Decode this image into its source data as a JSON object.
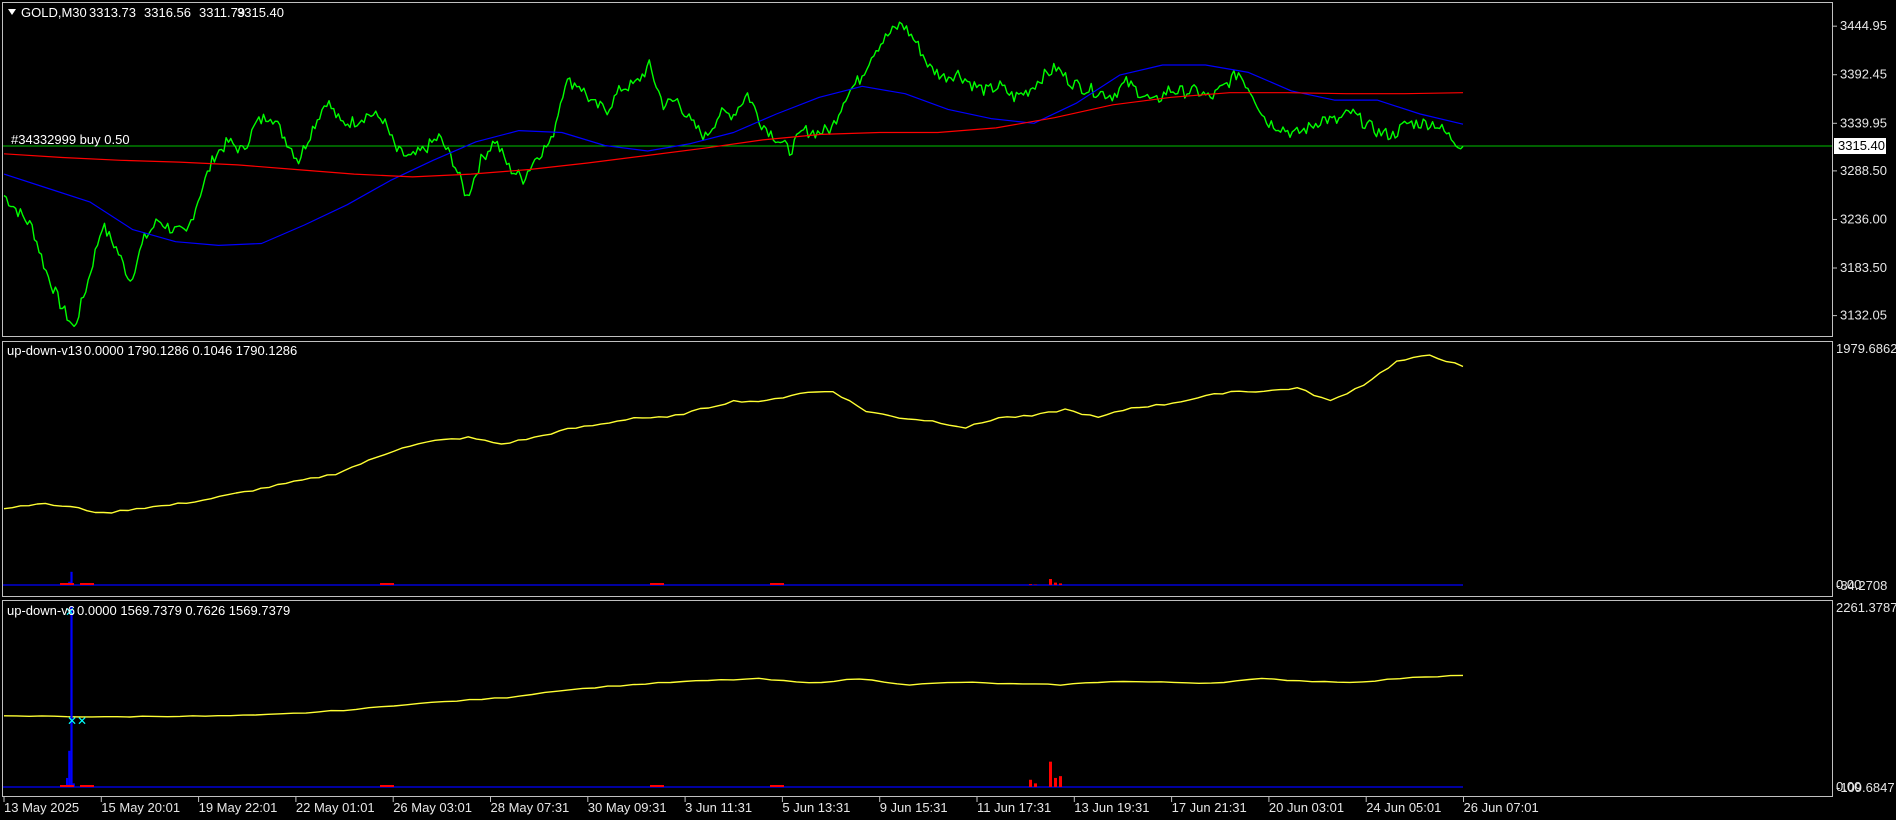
{
  "chart_data": [
    {
      "type": "line",
      "title": "GOLD,M30",
      "ohlc": {
        "open": "3313.73",
        "high": "3316.56",
        "low": "3311.79",
        "close": "3315.40"
      },
      "order_label": "#34332999 buy 0.50",
      "current_price_label": "3315.40",
      "current_price": 3315.4,
      "ylim": [
        3110,
        3470
      ],
      "y_ticks": [
        "3444.95",
        "3392.45",
        "3339.95",
        "3288.50",
        "3236.00",
        "3183.50",
        "3132.05"
      ],
      "y_tick_values": [
        3444.95,
        3392.45,
        3339.95,
        3288.5,
        3236.0,
        3183.5,
        3132.05
      ],
      "series": [
        {
          "color": "#00ff00",
          "values": [
            3262,
            3245,
            3228,
            3180,
            3145,
            3118,
            3170,
            3230,
            3205,
            3170,
            3215,
            3235,
            3225,
            3220,
            3265,
            3305,
            3320,
            3310,
            3340,
            3350,
            3325,
            3300,
            3335,
            3365,
            3340,
            3342,
            3350,
            3345,
            3310,
            3302,
            3312,
            3325,
            3300,
            3260,
            3300,
            3322,
            3292,
            3280,
            3305,
            3320,
            3385,
            3382,
            3360,
            3355,
            3378,
            3382,
            3402,
            3360,
            3365,
            3340,
            3325,
            3350,
            3350,
            3372,
            3340,
            3325,
            3310,
            3332,
            3330,
            3334,
            3370,
            3388,
            3418,
            3435,
            3448,
            3428,
            3400,
            3390,
            3394,
            3382,
            3375,
            3380,
            3368,
            3375,
            3390,
            3400,
            3385,
            3378,
            3374,
            3370,
            3384,
            3373,
            3362,
            3376,
            3374,
            3375,
            3367,
            3380,
            3395,
            3372,
            3342,
            3336,
            3328,
            3335,
            3345,
            3342,
            3352,
            3340,
            3330,
            3327,
            3340,
            3340,
            3340,
            3326,
            3315
          ]
        },
        {
          "color": "#0000ff",
          "values": [
            3285,
            3270,
            3255,
            3225,
            3212,
            3208,
            3210,
            3230,
            3252,
            3278,
            3300,
            3320,
            3332,
            3330,
            3316,
            3310,
            3318,
            3330,
            3350,
            3368,
            3380,
            3372,
            3355,
            3345,
            3340,
            3362,
            3392,
            3403,
            3403,
            3395,
            3375,
            3365,
            3365,
            3350,
            3339
          ]
        },
        {
          "color": "#ff0000",
          "values": [
            3307,
            3303,
            3300,
            3298,
            3295,
            3290,
            3285,
            3282,
            3285,
            3290,
            3297,
            3305,
            3313,
            3322,
            3328,
            3330,
            3330,
            3335,
            3346,
            3360,
            3368,
            3373,
            3373,
            3372,
            3372,
            3373
          ]
        }
      ]
    },
    {
      "type": "line",
      "title": "up-down-v13",
      "header_values": "0.0000 1790.1286 0.1046 1790.1286",
      "top_label": "1979.6862",
      "bottom_labels": [
        "0.00",
        "-84.2708"
      ],
      "series": [
        {
          "color": "#ffff33",
          "values": [
            0.07,
            0.1,
            0.08,
            0.04,
            0.07,
            0.09,
            0.12,
            0.16,
            0.2,
            0.24,
            0.28,
            0.36,
            0.44,
            0.48,
            0.5,
            0.46,
            0.5,
            0.55,
            0.58,
            0.62,
            0.62,
            0.67,
            0.72,
            0.72,
            0.77,
            0.78,
            0.66,
            0.62,
            0.6,
            0.56,
            0.62,
            0.63,
            0.67,
            0.62,
            0.68,
            0.7,
            0.74,
            0.78,
            0.78,
            0.8,
            0.72,
            0.82,
            0.96,
            1.0,
            0.93
          ]
        },
        {
          "color": "#0000ff",
          "values": [
            0.05,
            0.08,
            0.33,
            0.01,
            0.0,
            0.0,
            0.0
          ]
        },
        {
          "color": "#ff0000",
          "values": [
            0.0,
            0.02,
            0.01,
            0.0,
            0.0,
            0.15,
            0.06,
            0.04,
            0.0
          ]
        }
      ]
    },
    {
      "type": "line",
      "title": "up-down-v6",
      "header_values": "0.0000 1569.7379 0.7626 1569.7379",
      "top_label": "2261.3787",
      "bottom_labels": [
        "0.00",
        "-109.6847"
      ],
      "series": [
        {
          "color": "#ffff33",
          "values": [
            0.28,
            0.28,
            0.27,
            0.28,
            0.28,
            0.29,
            0.32,
            0.36,
            0.42,
            0.46,
            0.5,
            0.58,
            0.63,
            0.67,
            0.7,
            0.72,
            0.67,
            0.72,
            0.65,
            0.68,
            0.66,
            0.65,
            0.69,
            0.68,
            0.67,
            0.72,
            0.69,
            0.68,
            0.74,
            0.76
          ]
        },
        {
          "color": "#0000ff",
          "values": [
            0.05,
            0.2,
            1.0,
            0.02,
            0.0,
            0.0,
            0.0
          ]
        },
        {
          "color": "#ff0000",
          "values": [
            0.0,
            0.04,
            0.02,
            0.0,
            0.0,
            0.14,
            0.05,
            0.06,
            0.0
          ]
        }
      ]
    }
  ],
  "x_axis": {
    "labels": [
      "13 May 2025",
      "15 May 20:01",
      "19 May 22:01",
      "22 May 01:01",
      "26 May 03:01",
      "28 May 07:31",
      "30 May 09:31",
      "3 Jun 11:31",
      "5 Jun 13:31",
      "9 Jun 15:31",
      "11 Jun 17:31",
      "13 Jun 19:31",
      "17 Jun 21:31",
      "20 Jun 03:01",
      "24 Jun 05:01",
      "26 Jun 07:01"
    ]
  },
  "colors": {
    "background": "#000000",
    "frame": "#c0c0c0",
    "price_line": "#00ff00",
    "ma_fast": "#0000ff",
    "ma_slow": "#ff0000",
    "indicator_line": "#ffff33",
    "marker": "#00ffff"
  }
}
